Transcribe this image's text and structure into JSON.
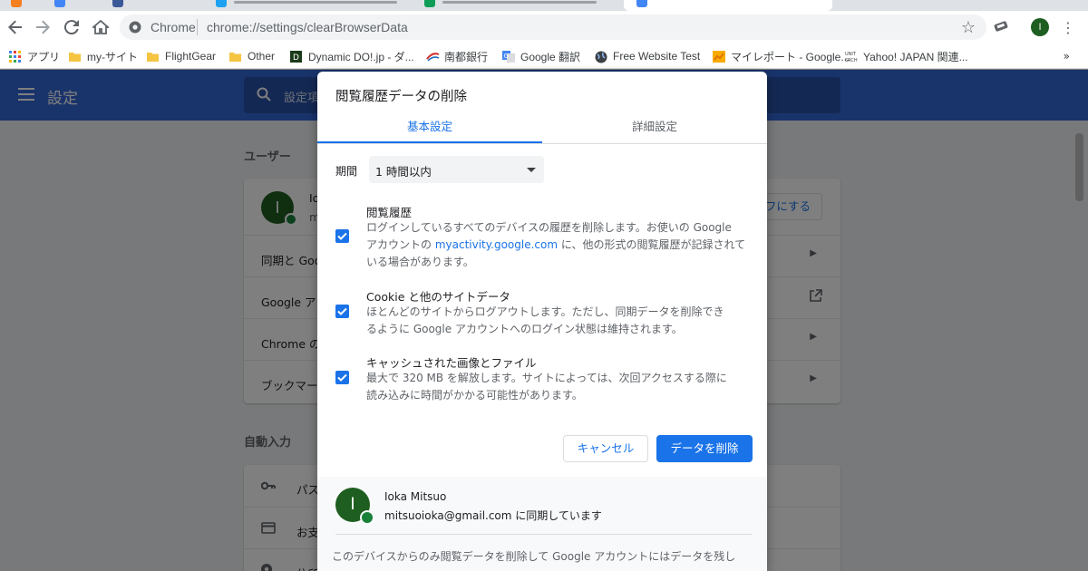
{
  "browser": {
    "address_scheme": "Chrome",
    "address_url": "chrome://settings/clearBrowserData",
    "profile_initial": "I",
    "bookmarks": [
      {
        "label": "アプリ",
        "icon": "apps-grid-icon"
      },
      {
        "label": "my-サイト",
        "icon": "folder-icon"
      },
      {
        "label": "FlightGear",
        "icon": "folder-icon"
      },
      {
        "label": "Other",
        "icon": "folder-icon"
      },
      {
        "label": "Dynamic DO!.jp - ダ...",
        "icon": "site-favicon"
      },
      {
        "label": "南都銀行",
        "icon": "site-favicon"
      },
      {
        "label": "Google 翻訳",
        "icon": "translate-icon"
      },
      {
        "label": "Free Website Test",
        "icon": "globe-icon"
      },
      {
        "label": "マイレポート - Google...",
        "icon": "analytics-icon"
      },
      {
        "label": "Yahoo! JAPAN 関連...",
        "icon": "site-favicon"
      }
    ],
    "bookmarks_more": "»"
  },
  "settings": {
    "title": "設定",
    "search_placeholder": "設定項",
    "people_section": "ユーザー",
    "autofill_section": "自動入力",
    "account_initial": "I",
    "account_name_partial": "Io",
    "account_email_partial": "m",
    "turn_off_button": "フにする",
    "rows": [
      {
        "label": "同期と Goo"
      },
      {
        "label": "Google アカ"
      },
      {
        "label": "Chrome の"
      },
      {
        "label": "ブックマー"
      }
    ],
    "autofill_rows": [
      {
        "label": "パス",
        "icon": "key-icon"
      },
      {
        "label": "お支",
        "icon": "credit-card-icon"
      },
      {
        "label": "住所",
        "icon": "location-pin-icon"
      }
    ]
  },
  "dialog": {
    "title": "閲覧履歴データの削除",
    "tab_basic": "基本設定",
    "tab_advanced": "詳細設定",
    "period_label": "期間",
    "period_value": "1 時間以内",
    "options": [
      {
        "title": "閲覧履歴",
        "desc_lines": [
          "ログインしているすべてのデバイスの履歴を削除します。お使いの Google",
          "アカウントの myactivity.google.com に、他の形式の閲覧履歴が記録されて",
          "いる場合があります。"
        ],
        "link": "myactivity.google.com",
        "checked": true
      },
      {
        "title": "Cookie と他のサイトデータ",
        "desc_lines": [
          "ほとんどのサイトからログアウトします。ただし、同期データを削除でき",
          "るように Google アカウントへのログイン状態は維持されます。"
        ],
        "checked": true
      },
      {
        "title": "キャッシュされた画像とファイル",
        "desc_lines": [
          "最大で 320 MB を解放します。サイトによっては、次回アクセスする際に",
          "読み込みに時間がかかる可能性があります。"
        ],
        "checked": true
      }
    ],
    "cancel_label": "キャンセル",
    "delete_label": "データを削除",
    "footer": {
      "avatar_initial": "I",
      "name": "Ioka Mitsuo",
      "email_line": "mitsuoioka@gmail.com に同期しています",
      "note": "このデバイスからのみ閲覧データを削除して Google アカウントにはデータを残し"
    }
  },
  "colors": {
    "accent": "#1a73e8",
    "settings_header": "#3367d6",
    "avatar": "#1e5e20"
  }
}
